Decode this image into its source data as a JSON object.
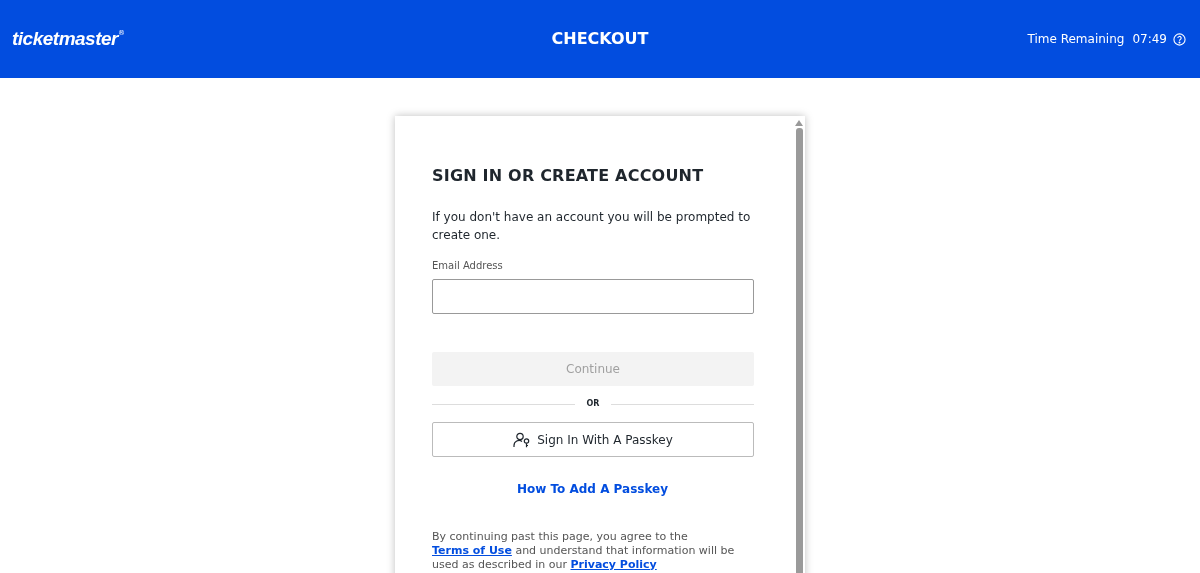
{
  "header": {
    "logo": "ticketmaster",
    "logo_mark": "®",
    "title": "CHECKOUT",
    "timer_label": "Time Remaining",
    "timer_value": "07:49"
  },
  "form": {
    "title": "SIGN IN OR CREATE ACCOUNT",
    "intro": "If you don't have an account you will be prompted to create one.",
    "email": {
      "label": "Email Address"
    },
    "continue_button": {
      "label": "Continue",
      "disabled": true
    },
    "divider": "OR",
    "passkey_button": "Sign In With A Passkey",
    "help_link": "How To Add A Passkey",
    "legal": {
      "before": "By continuing past this page, you agree to the ",
      "terms_link": "Terms of Use",
      "middle": " and understand that information will be used as described in our ",
      "privacy_link": "Privacy Policy"
    }
  }
}
